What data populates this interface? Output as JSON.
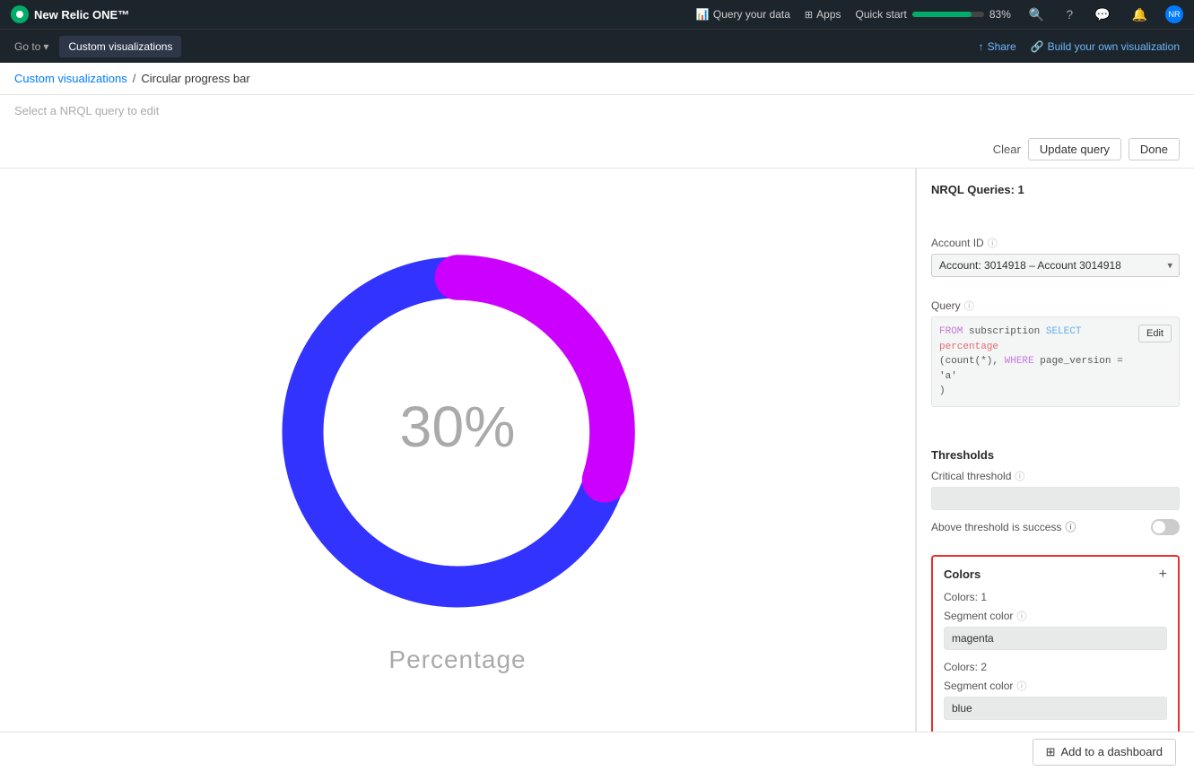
{
  "brand": {
    "name": "New Relic ONE™"
  },
  "topnav": {
    "query_data": "Query your data",
    "apps": "Apps",
    "quick_start": "Quick start",
    "progress_pct": "83%"
  },
  "subnav": {
    "goto": "Go to",
    "custom_viz_btn": "Custom visualizations",
    "share": "Share",
    "build_own": "Build your own visualization"
  },
  "breadcrumb": {
    "parent": "Custom visualizations",
    "separator": "/",
    "current": "Circular progress bar"
  },
  "query_bar": {
    "placeholder": "Select a NRQL query to edit",
    "clear": "Clear",
    "update_query": "Update query",
    "done": "Done"
  },
  "right_panel": {
    "nrql_queries_label": "NRQL Queries: 1",
    "account_id_label": "Account ID",
    "account_value": "Account: 3014918 – Account 3014918",
    "query_label": "Query",
    "query_from": "FROM subscription SELECT percentage",
    "query_from_kw": "FROM",
    "query_table": "subscription",
    "query_select_kw": "SELECT",
    "query_field": "percentage",
    "query_rest": "(count(*), WHERE page_version = 'a')",
    "edit_btn": "Edit",
    "thresholds_title": "Thresholds",
    "critical_threshold_label": "Critical threshold",
    "above_threshold_label": "Above threshold is success",
    "colors_title": "Colors",
    "add_btn": "+",
    "colors_1_label": "Colors: 1",
    "segment_color_label": "Segment color",
    "segment_color_1_value": "magenta",
    "colors_2_label": "Colors: 2",
    "segment_color_2_value": "blue"
  },
  "visualization": {
    "percentage": "30%",
    "label": "Percentage",
    "value": 30,
    "color_filled": "#cc00ff",
    "color_track": "#3333ff"
  },
  "bottom_bar": {
    "add_to_dashboard": "Add to a dashboard"
  }
}
